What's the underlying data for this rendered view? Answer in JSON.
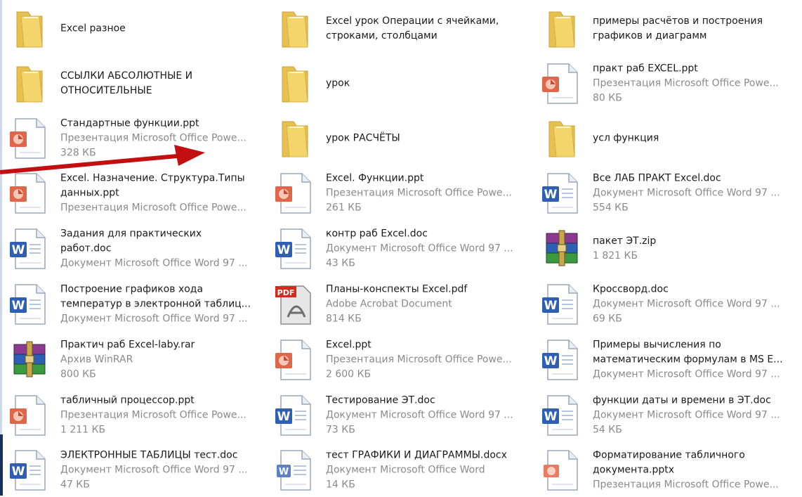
{
  "colors": {
    "arrow": "#c40f12",
    "meta_text": "#8a8a8a",
    "folder": "#f3d56c",
    "word": "#2f5fb3",
    "ppt": "#e0664a",
    "pdf": "#d52b1e"
  },
  "items": [
    {
      "icon": "folder-icon",
      "lines": [
        "Excel разное"
      ]
    },
    {
      "icon": "folder-icon",
      "lines": [
        "Excel урок Операции с ячейками,",
        "строками, столбцами"
      ]
    },
    {
      "icon": "folder-icon",
      "lines": [
        "примеры расчётов и построения",
        "графиков и диаграмм"
      ]
    },
    {
      "icon": "folder-icon",
      "lines": [
        "ССЫЛКИ АБСОЛЮТНЫЕ И",
        "ОТНОСИТЕЛЬНЫЕ"
      ]
    },
    {
      "icon": "folder-icon",
      "lines": [
        "урок"
      ]
    },
    {
      "icon": "ppt-icon",
      "lines": [
        "практ раб EXCEL.ppt",
        "Презентация Microsoft Office Powe...",
        "80 КБ"
      ]
    },
    {
      "icon": "ppt-icon",
      "lines": [
        "Стандартные функции.ppt",
        "Презентация Microsoft Office Powe...",
        "328 КБ"
      ]
    },
    {
      "icon": "folder-icon",
      "lines": [
        "урок РАСЧЁТЫ"
      ]
    },
    {
      "icon": "folder-icon",
      "lines": [
        "усл функция"
      ]
    },
    {
      "icon": "ppt-icon",
      "lines": [
        "Excel. Назначение. Структура.Типы",
        "данных.ppt",
        "Презентация Microsoft Office Powe..."
      ]
    },
    {
      "icon": "ppt-icon",
      "lines": [
        "Excel. Функции.ppt",
        "Презентация Microsoft Office Powe...",
        "261 КБ"
      ]
    },
    {
      "icon": "word-icon",
      "lines": [
        "Все ЛАБ ПРАКТ Excel.doc",
        "Документ Microsoft Office Word 97 ...",
        "554 КБ"
      ]
    },
    {
      "icon": "word-icon",
      "lines": [
        "Задания для практических",
        "работ.doc",
        "Документ Microsoft Office Word 97 ..."
      ]
    },
    {
      "icon": "word-icon",
      "lines": [
        "контр раб Excel.doc",
        "Документ Microsoft Office Word 97 ...",
        "43 КБ"
      ]
    },
    {
      "icon": "winrar-icon",
      "lines": [
        "пакет ЭТ.zip",
        "1 821 КБ"
      ]
    },
    {
      "icon": "word-icon",
      "lines": [
        "Построение графиков хода",
        "температур в электронной таблиц...",
        "Документ Microsoft Office Word 97 ..."
      ]
    },
    {
      "icon": "pdf-icon",
      "lines": [
        "Планы-конспекты Excel.pdf",
        "Adobe Acrobat Document",
        "814 КБ"
      ]
    },
    {
      "icon": "word-icon",
      "lines": [
        "Кроссворд.doc",
        "Документ Microsoft Office Word 97 ...",
        "69 КБ"
      ]
    },
    {
      "icon": "winrar-icon",
      "lines": [
        "Практич раб Excel-laby.rar",
        "Архив WinRAR",
        "800 КБ"
      ]
    },
    {
      "icon": "ppt-icon",
      "lines": [
        "Excel.ppt",
        "Презентация Microsoft Office Powe...",
        "2 600 КБ"
      ]
    },
    {
      "icon": "word-icon",
      "lines": [
        "Примеры вычисления по",
        "математическим формулам в MS E...",
        "Документ Microsoft Office Word 97 ..."
      ]
    },
    {
      "icon": "ppt-icon",
      "lines": [
        "табличный процессор.ppt",
        "Презентация Microsoft Office Powe...",
        "1 211 КБ"
      ]
    },
    {
      "icon": "word-icon",
      "lines": [
        "Тестирование ЭТ.doc",
        "Документ Microsoft Office Word 97 ...",
        "73 КБ"
      ]
    },
    {
      "icon": "word-icon",
      "lines": [
        "функции даты и времени в ЭТ.doc",
        "Документ Microsoft Office Word 97 ...",
        "54 КБ"
      ]
    },
    {
      "icon": "word-icon",
      "lines": [
        "ЭЛЕКТРОННЫЕ ТАБЛИЦЫ тест.doc",
        "Документ Microsoft Office Word 97 ...",
        "47 КБ"
      ]
    },
    {
      "icon": "docx-icon",
      "lines": [
        "тест ГРАФИКИ И ДИАГРАММЫ.docx",
        "Документ Microsoft Office Word",
        "14 КБ"
      ]
    },
    {
      "icon": "pptx-icon",
      "lines": [
        "Форматирование табличного",
        "документа.pptx",
        "Презентация Microsoft Office Powe..."
      ]
    }
  ]
}
